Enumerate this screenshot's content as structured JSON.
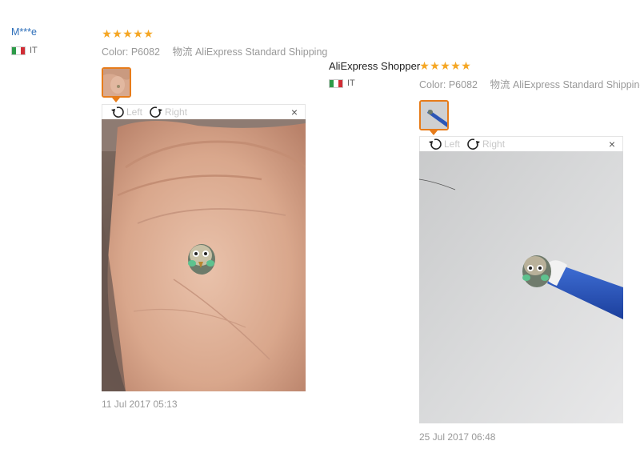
{
  "reviews": [
    {
      "user": "M***e",
      "country": "IT",
      "rating": 5,
      "color_label": "Color:",
      "color_value": "P6082",
      "shipping_label": "物流",
      "shipping_value": "AliExpress Standard Shipping",
      "rotate_left": "Left",
      "rotate_right": "Right",
      "close": "×",
      "date": "11 Jul 2017 05:13"
    },
    {
      "user": "AliExpress Shopper",
      "country": "IT",
      "rating": 5,
      "color_label": "Color:",
      "color_value": "P6082",
      "shipping_label": "物流",
      "shipping_value": "AliExpress Standard Shipping",
      "rotate_left": "Left",
      "rotate_right": "Right",
      "close": "×",
      "date": "25 Jul 2017 06:48"
    }
  ],
  "colors": {
    "link_blue": "#2e6fba",
    "star_orange": "#f5a623",
    "thumb_border": "#e77c1a",
    "muted_text": "#999999"
  },
  "icons": {
    "star": "star-icon",
    "flag": "italy-flag-icon",
    "rotate_left": "rotate-left-icon",
    "rotate_right": "rotate-right-icon",
    "close": "close-icon"
  }
}
